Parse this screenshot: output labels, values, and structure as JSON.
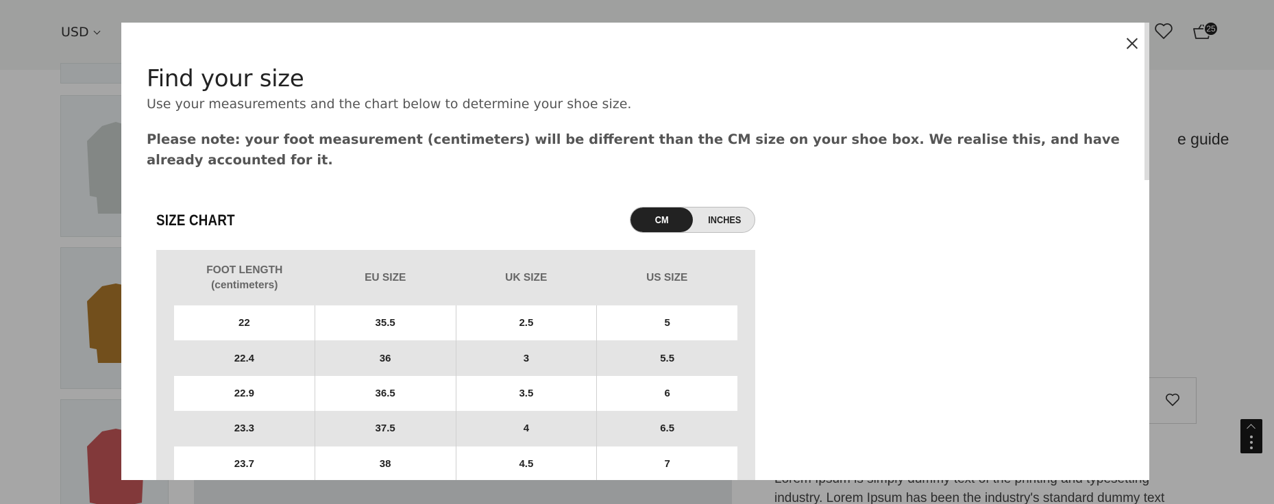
{
  "header": {
    "currency": "USD",
    "cart_count": "25"
  },
  "background": {
    "size_guide_text": "e guide",
    "description": "Lorem Ipsum is simply dummy text of the printing and typesetting industry. Lorem Ipsum has been the industry's standard dummy text"
  },
  "modal": {
    "title": "Find your size",
    "subtitle": "Use your measurements and the chart below to determine your shoe size.",
    "note": "Please note: your foot measurement (centimeters) will be different than the CM size on your shoe box. We realise this, and have already accounted for it.",
    "chart_title": "SIZE CHART",
    "toggle": {
      "cm_label": "CM",
      "inches_label": "INCHES",
      "selected": "CM"
    },
    "table": {
      "headers": [
        {
          "line1": "FOOT LENGTH",
          "line2": "(centimeters)"
        },
        {
          "line1": "EU SIZE",
          "line2": ""
        },
        {
          "line1": "UK SIZE",
          "line2": ""
        },
        {
          "line1": "US SIZE",
          "line2": ""
        }
      ],
      "rows": [
        [
          "22",
          "35.5",
          "2.5",
          "5"
        ],
        [
          "22.4",
          "36",
          "3",
          "5.5"
        ],
        [
          "22.9",
          "36.5",
          "3.5",
          "6"
        ],
        [
          "23.3",
          "37.5",
          "4",
          "6.5"
        ],
        [
          "23.7",
          "38",
          "4.5",
          "7"
        ]
      ]
    }
  },
  "colors": {
    "toggle_active": "#222222",
    "table_bg": "#e4e4e4",
    "shirt_gray": "#c9cfcc",
    "shirt_brown": "#b07a2c",
    "shirt_red": "#c8585a"
  }
}
